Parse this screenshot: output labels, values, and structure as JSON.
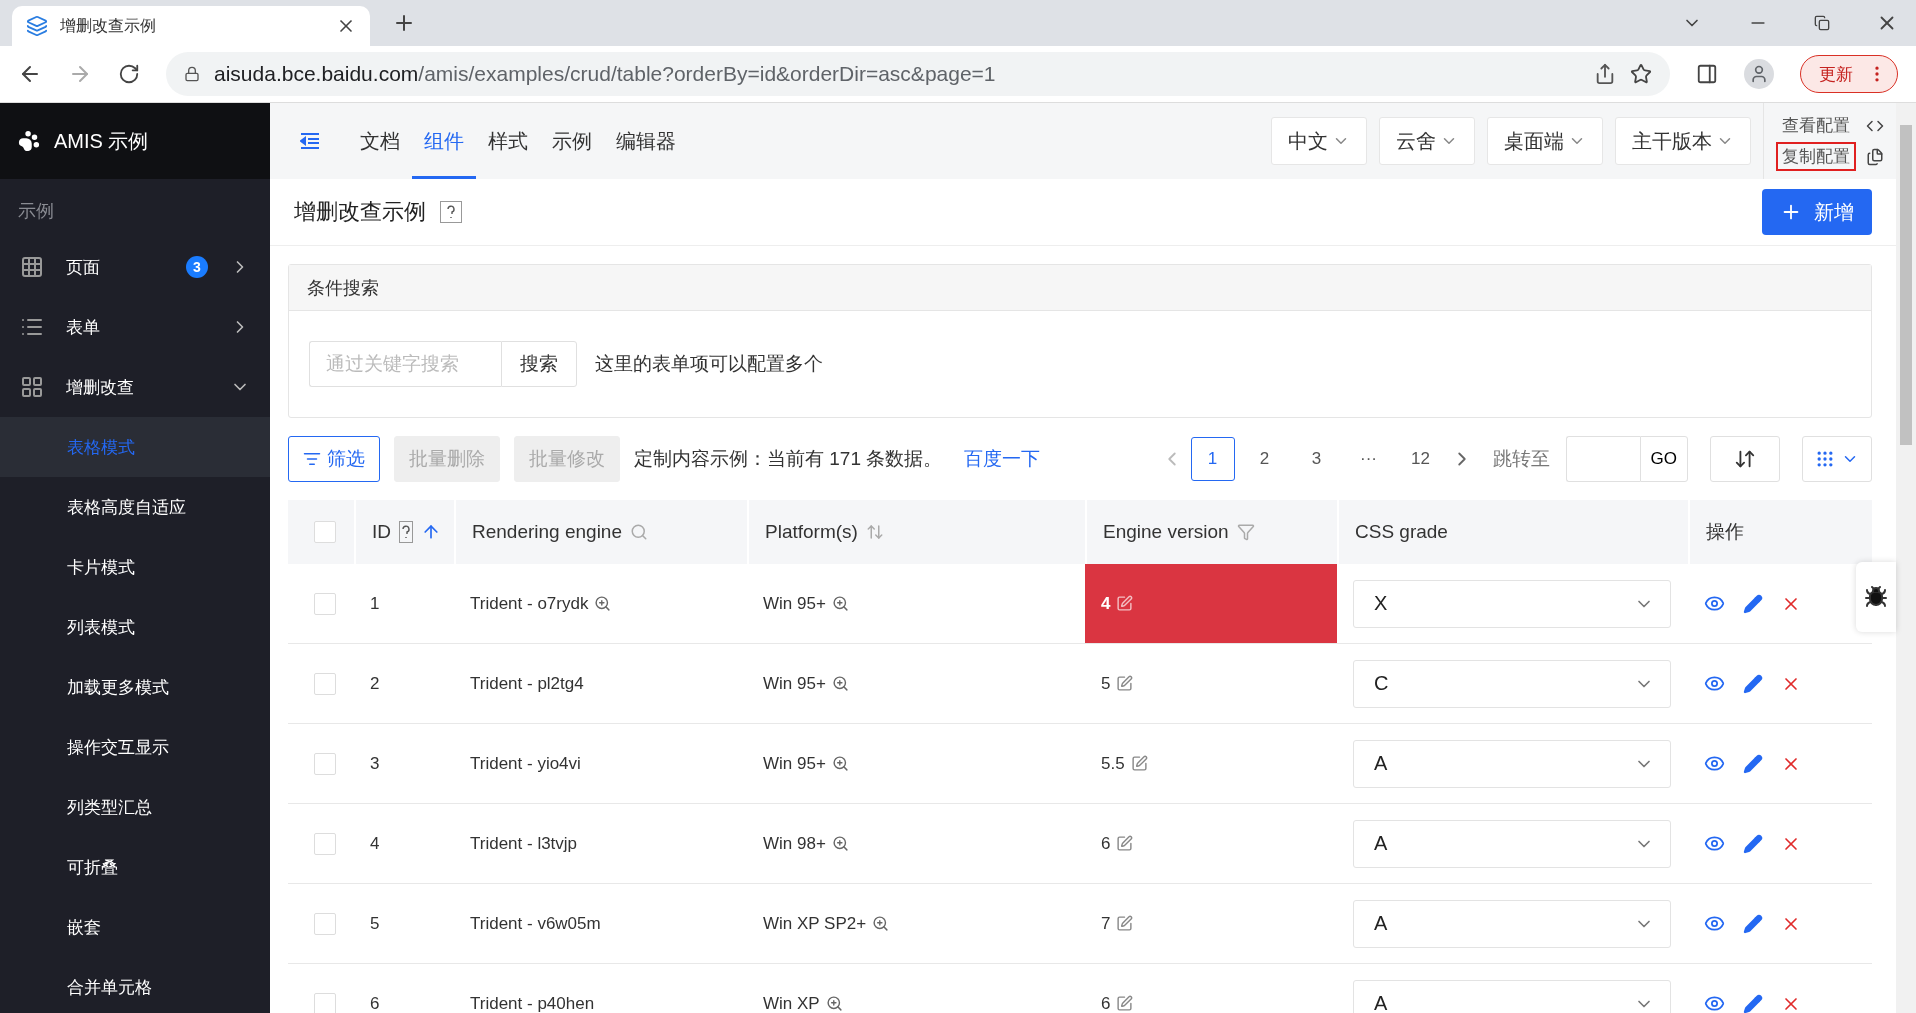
{
  "browser": {
    "tab_title": "增删改查示例",
    "url_host": "aisuda.bce.baidu.com",
    "url_path": "/amis/examples/crud/table?orderBy=id&orderDir=asc&page=1",
    "update_button": "更新"
  },
  "sidebar": {
    "brand": "AMIS 示例",
    "section": "示例",
    "items": [
      {
        "label": "页面",
        "kind": "grid",
        "badge": "3",
        "expanded": false
      },
      {
        "label": "表单",
        "kind": "list",
        "expanded": false
      },
      {
        "label": "增删改查",
        "kind": "table",
        "expanded": true,
        "children": [
          {
            "label": "表格模式",
            "selected": true
          },
          {
            "label": "表格高度自适应",
            "selected": false
          },
          {
            "label": "卡片模式",
            "selected": false
          },
          {
            "label": "列表模式",
            "selected": false
          },
          {
            "label": "加载更多模式",
            "selected": false
          },
          {
            "label": "操作交互显示",
            "selected": false
          },
          {
            "label": "列类型汇总",
            "selected": false
          },
          {
            "label": "可折叠",
            "selected": false
          },
          {
            "label": "嵌套",
            "selected": false
          },
          {
            "label": "合并单元格",
            "selected": false
          }
        ]
      }
    ]
  },
  "topnav": {
    "items": [
      {
        "label": "文档",
        "selected": false
      },
      {
        "label": "组件",
        "selected": true
      },
      {
        "label": "样式",
        "selected": false
      },
      {
        "label": "示例",
        "selected": false
      },
      {
        "label": "编辑器",
        "selected": false
      }
    ],
    "dropdowns": [
      "中文",
      "云舍",
      "桌面端",
      "主干版本"
    ],
    "links": [
      {
        "label": "查看配置",
        "kind": "code",
        "outlined": false
      },
      {
        "label": "复制配置",
        "kind": "copy",
        "outlined": true
      }
    ]
  },
  "page": {
    "title": "增删改查示例",
    "add_button": "新增"
  },
  "search_panel": {
    "title": "条件搜索",
    "placeholder": "通过关键字搜索",
    "button": "搜索",
    "hint": "这里的表单项可以配置多个"
  },
  "toolbar": {
    "filter_button": "筛选",
    "bulk_buttons": [
      {
        "label": "批量删除",
        "disabled": true
      },
      {
        "label": "批量修改",
        "disabled": true
      }
    ],
    "summary": "定制内容示例：当前有 171 条数据。",
    "link": "百度一下",
    "pages": [
      {
        "label": "1",
        "selected": true
      },
      {
        "label": "2",
        "selected": false
      },
      {
        "label": "3",
        "selected": false
      },
      {
        "label": "···",
        "selected": false
      },
      {
        "label": "12",
        "selected": false
      }
    ],
    "jump_label": "跳转至",
    "go_button": "GO"
  },
  "table": {
    "select_all_checked": false,
    "columns": [
      {
        "label": "ID",
        "kind": "sorted"
      },
      {
        "label": "Rendering engine",
        "kind": "search"
      },
      {
        "label": "Platform(s)",
        "kind": "sortable"
      },
      {
        "label": "Engine version",
        "kind": "filter"
      },
      {
        "label": "CSS grade",
        "kind": "plain"
      },
      {
        "label": "操作",
        "kind": "plain"
      }
    ],
    "rows": [
      {
        "id": "1",
        "engine": "Trident - o7rydk",
        "platform": "Win 95+",
        "version": "4",
        "grade": "X",
        "highlighted": true,
        "hovered": true,
        "checked": false
      },
      {
        "id": "2",
        "engine": "Trident - pl2tg4",
        "platform": "Win 95+",
        "version": "5",
        "grade": "C",
        "highlighted": false,
        "hovered": false,
        "checked": false
      },
      {
        "id": "3",
        "engine": "Trident - yio4vi",
        "platform": "Win 95+",
        "version": "5.5",
        "grade": "A",
        "highlighted": false,
        "hovered": false,
        "checked": false
      },
      {
        "id": "4",
        "engine": "Trident - l3tvjp",
        "platform": "Win 98+",
        "version": "6",
        "grade": "A",
        "highlighted": false,
        "hovered": false,
        "checked": false
      },
      {
        "id": "5",
        "engine": "Trident - v6w05m",
        "platform": "Win XP SP2+",
        "version": "7",
        "grade": "A",
        "highlighted": false,
        "hovered": false,
        "checked": false
      },
      {
        "id": "6",
        "engine": "Trident - p40hen",
        "platform": "Win XP",
        "version": "6",
        "grade": "A",
        "highlighted": false,
        "hovered": false,
        "checked": false
      }
    ]
  }
}
